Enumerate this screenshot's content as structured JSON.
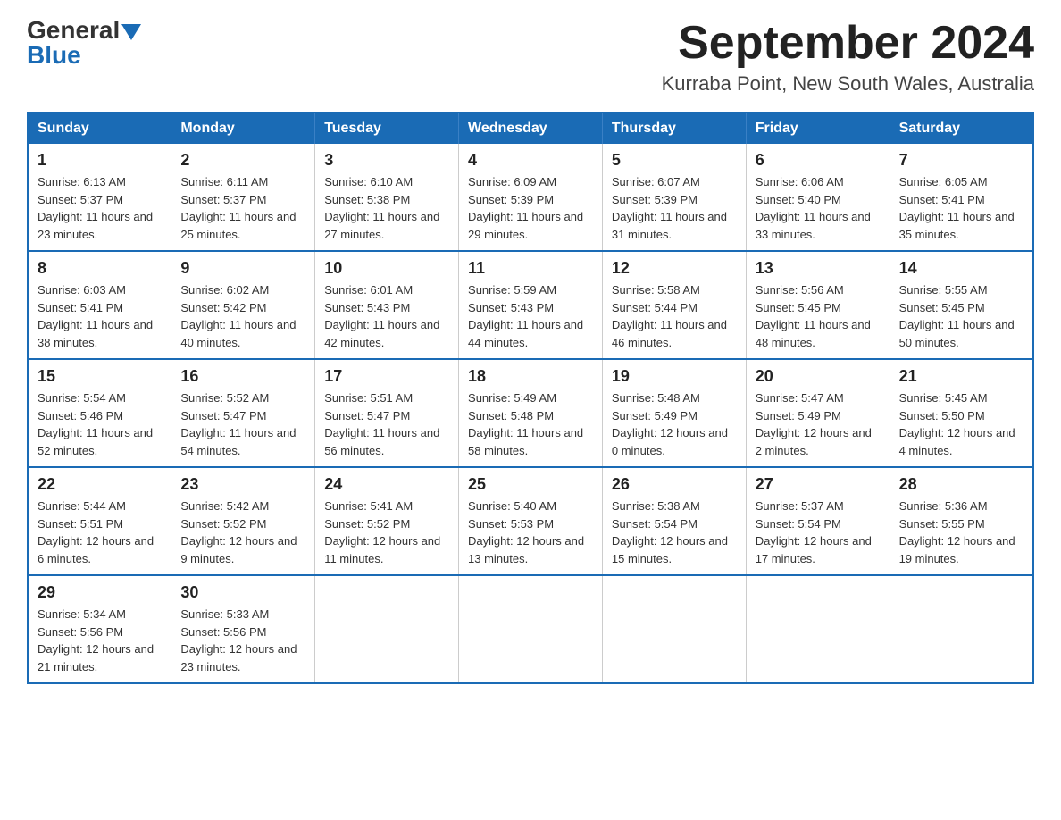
{
  "logo": {
    "general": "General",
    "blue": "Blue"
  },
  "header": {
    "month_year": "September 2024",
    "location": "Kurraba Point, New South Wales, Australia"
  },
  "weekdays": [
    "Sunday",
    "Monday",
    "Tuesday",
    "Wednesday",
    "Thursday",
    "Friday",
    "Saturday"
  ],
  "weeks": [
    [
      {
        "day": "1",
        "sunrise": "6:13 AM",
        "sunset": "5:37 PM",
        "daylight": "11 hours and 23 minutes."
      },
      {
        "day": "2",
        "sunrise": "6:11 AM",
        "sunset": "5:37 PM",
        "daylight": "11 hours and 25 minutes."
      },
      {
        "day": "3",
        "sunrise": "6:10 AM",
        "sunset": "5:38 PM",
        "daylight": "11 hours and 27 minutes."
      },
      {
        "day": "4",
        "sunrise": "6:09 AM",
        "sunset": "5:39 PM",
        "daylight": "11 hours and 29 minutes."
      },
      {
        "day": "5",
        "sunrise": "6:07 AM",
        "sunset": "5:39 PM",
        "daylight": "11 hours and 31 minutes."
      },
      {
        "day": "6",
        "sunrise": "6:06 AM",
        "sunset": "5:40 PM",
        "daylight": "11 hours and 33 minutes."
      },
      {
        "day": "7",
        "sunrise": "6:05 AM",
        "sunset": "5:41 PM",
        "daylight": "11 hours and 35 minutes."
      }
    ],
    [
      {
        "day": "8",
        "sunrise": "6:03 AM",
        "sunset": "5:41 PM",
        "daylight": "11 hours and 38 minutes."
      },
      {
        "day": "9",
        "sunrise": "6:02 AM",
        "sunset": "5:42 PM",
        "daylight": "11 hours and 40 minutes."
      },
      {
        "day": "10",
        "sunrise": "6:01 AM",
        "sunset": "5:43 PM",
        "daylight": "11 hours and 42 minutes."
      },
      {
        "day": "11",
        "sunrise": "5:59 AM",
        "sunset": "5:43 PM",
        "daylight": "11 hours and 44 minutes."
      },
      {
        "day": "12",
        "sunrise": "5:58 AM",
        "sunset": "5:44 PM",
        "daylight": "11 hours and 46 minutes."
      },
      {
        "day": "13",
        "sunrise": "5:56 AM",
        "sunset": "5:45 PM",
        "daylight": "11 hours and 48 minutes."
      },
      {
        "day": "14",
        "sunrise": "5:55 AM",
        "sunset": "5:45 PM",
        "daylight": "11 hours and 50 minutes."
      }
    ],
    [
      {
        "day": "15",
        "sunrise": "5:54 AM",
        "sunset": "5:46 PM",
        "daylight": "11 hours and 52 minutes."
      },
      {
        "day": "16",
        "sunrise": "5:52 AM",
        "sunset": "5:47 PM",
        "daylight": "11 hours and 54 minutes."
      },
      {
        "day": "17",
        "sunrise": "5:51 AM",
        "sunset": "5:47 PM",
        "daylight": "11 hours and 56 minutes."
      },
      {
        "day": "18",
        "sunrise": "5:49 AM",
        "sunset": "5:48 PM",
        "daylight": "11 hours and 58 minutes."
      },
      {
        "day": "19",
        "sunrise": "5:48 AM",
        "sunset": "5:49 PM",
        "daylight": "12 hours and 0 minutes."
      },
      {
        "day": "20",
        "sunrise": "5:47 AM",
        "sunset": "5:49 PM",
        "daylight": "12 hours and 2 minutes."
      },
      {
        "day": "21",
        "sunrise": "5:45 AM",
        "sunset": "5:50 PM",
        "daylight": "12 hours and 4 minutes."
      }
    ],
    [
      {
        "day": "22",
        "sunrise": "5:44 AM",
        "sunset": "5:51 PM",
        "daylight": "12 hours and 6 minutes."
      },
      {
        "day": "23",
        "sunrise": "5:42 AM",
        "sunset": "5:52 PM",
        "daylight": "12 hours and 9 minutes."
      },
      {
        "day": "24",
        "sunrise": "5:41 AM",
        "sunset": "5:52 PM",
        "daylight": "12 hours and 11 minutes."
      },
      {
        "day": "25",
        "sunrise": "5:40 AM",
        "sunset": "5:53 PM",
        "daylight": "12 hours and 13 minutes."
      },
      {
        "day": "26",
        "sunrise": "5:38 AM",
        "sunset": "5:54 PM",
        "daylight": "12 hours and 15 minutes."
      },
      {
        "day": "27",
        "sunrise": "5:37 AM",
        "sunset": "5:54 PM",
        "daylight": "12 hours and 17 minutes."
      },
      {
        "day": "28",
        "sunrise": "5:36 AM",
        "sunset": "5:55 PM",
        "daylight": "12 hours and 19 minutes."
      }
    ],
    [
      {
        "day": "29",
        "sunrise": "5:34 AM",
        "sunset": "5:56 PM",
        "daylight": "12 hours and 21 minutes."
      },
      {
        "day": "30",
        "sunrise": "5:33 AM",
        "sunset": "5:56 PM",
        "daylight": "12 hours and 23 minutes."
      },
      null,
      null,
      null,
      null,
      null
    ]
  ],
  "labels": {
    "sunrise": "Sunrise:",
    "sunset": "Sunset:",
    "daylight": "Daylight:"
  }
}
